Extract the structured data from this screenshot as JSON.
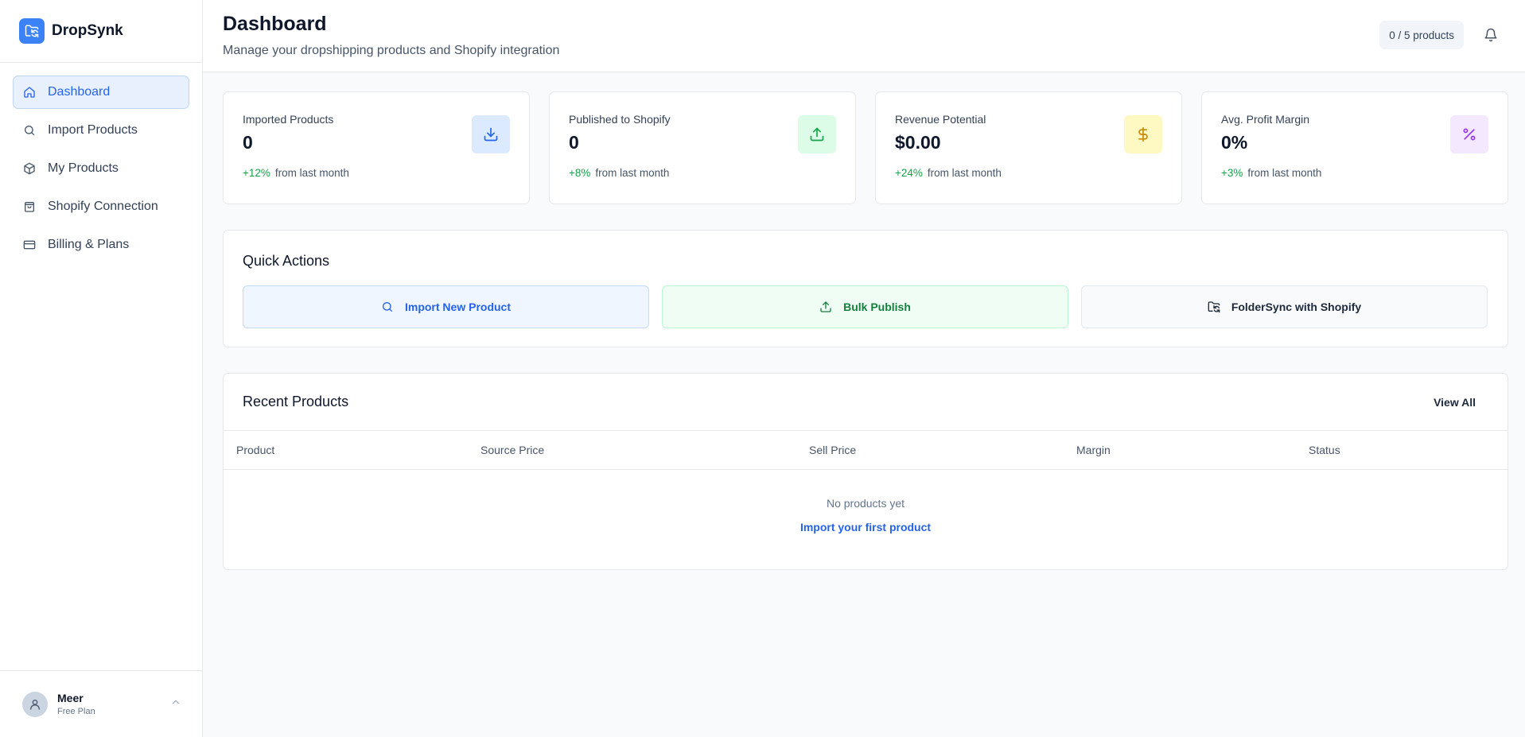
{
  "brand": {
    "name": "DropSynk"
  },
  "sidebar": {
    "items": [
      {
        "label": "Dashboard",
        "icon": "home-icon",
        "active": true
      },
      {
        "label": "Import Products",
        "icon": "search-icon"
      },
      {
        "label": "My Products",
        "icon": "package-icon"
      },
      {
        "label": "Shopify Connection",
        "icon": "shopping-bag-icon"
      },
      {
        "label": "Billing & Plans",
        "icon": "credit-card-icon"
      }
    ]
  },
  "user": {
    "name": "Meer",
    "plan": "Free Plan"
  },
  "header": {
    "title": "Dashboard",
    "subtitle": "Manage your dropshipping products and Shopify integration",
    "quota": "0 / 5 products"
  },
  "stats": [
    {
      "label": "Imported Products",
      "value": "0",
      "change": "+12%",
      "change_suffix": "from last month",
      "icon": "download-icon",
      "color": "#2563eb",
      "bg": "#dbeafe"
    },
    {
      "label": "Published to Shopify",
      "value": "0",
      "change": "+8%",
      "change_suffix": "from last month",
      "icon": "upload-icon",
      "color": "#16a34a",
      "bg": "#dcfce7"
    },
    {
      "label": "Revenue Potential",
      "value": "$0.00",
      "change": "+24%",
      "change_suffix": "from last month",
      "icon": "dollar-icon",
      "color": "#ca8a04",
      "bg": "#fef9c3"
    },
    {
      "label": "Avg. Profit Margin",
      "value": "0%",
      "change": "+3%",
      "change_suffix": "from last month",
      "icon": "percent-icon",
      "color": "#9333ea",
      "bg": "#f3e8ff"
    }
  ],
  "quick_actions": {
    "title": "Quick Actions",
    "buttons": [
      {
        "label": "Import New Product",
        "icon": "search-icon"
      },
      {
        "label": "Bulk Publish",
        "icon": "upload-icon"
      },
      {
        "label": "FolderSync with Shopify",
        "icon": "folder-sync-icon"
      }
    ]
  },
  "recent": {
    "title": "Recent Products",
    "view_all": "View All",
    "columns": [
      "Product",
      "Source Price",
      "Sell Price",
      "Margin",
      "Status"
    ],
    "empty_text": "No products yet",
    "empty_link": "Import your first product"
  },
  "colors": {
    "accent": "#3b82f6",
    "positive": "#16a34a"
  }
}
